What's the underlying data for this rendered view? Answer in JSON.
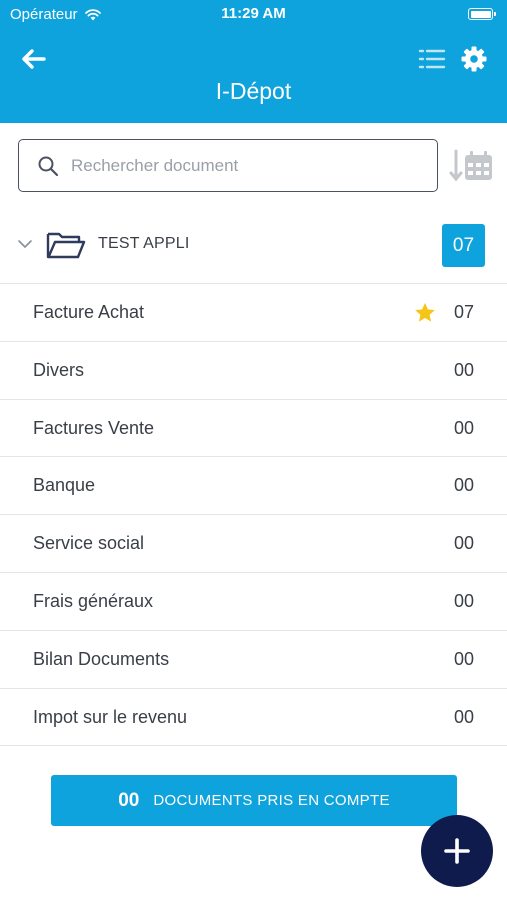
{
  "status_bar": {
    "carrier": "Opérateur",
    "time": "11:29 AM"
  },
  "header": {
    "title": "I-Dépot"
  },
  "search": {
    "placeholder": "Rechercher document",
    "value": ""
  },
  "folder": {
    "name": "TEST APPLI",
    "count": "07"
  },
  "categories": [
    {
      "label": "Facture Achat",
      "count": "07",
      "starred": true
    },
    {
      "label": "Divers",
      "count": "00"
    },
    {
      "label": "Factures Vente",
      "count": "00"
    },
    {
      "label": "Banque",
      "count": "00"
    },
    {
      "label": "Service social",
      "count": "00"
    },
    {
      "label": "Frais généraux",
      "count": "00"
    },
    {
      "label": "Bilan Documents",
      "count": "00"
    },
    {
      "label": "Impot sur le revenu",
      "count": "00"
    }
  ],
  "summary": {
    "count": "00",
    "label": "DOCUMENTS PRIS EN COMPTE"
  },
  "colors": {
    "accent": "#0ea3dc",
    "fab": "#0f1b4c",
    "star": "#f5c518",
    "text": "#3a3f47"
  },
  "icons": [
    "wifi-icon",
    "battery-icon",
    "back-arrow-icon",
    "list-icon",
    "gear-icon",
    "search-icon",
    "sort-date-icon",
    "chevron-down-icon",
    "folder-icon",
    "star-icon",
    "plus-icon"
  ]
}
